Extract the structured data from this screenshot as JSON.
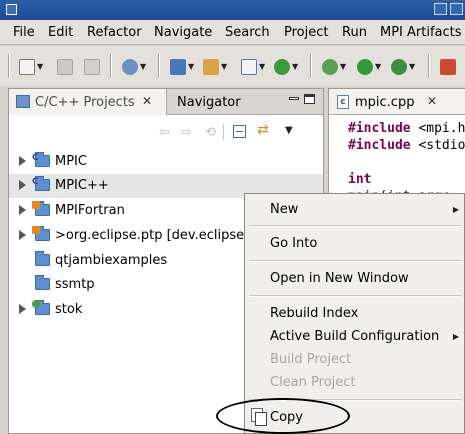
{
  "menubar": {
    "items": [
      "File",
      "Edit",
      "Refactor",
      "Navigate",
      "Search",
      "Project",
      "Run",
      "MPI Artifacts"
    ]
  },
  "project_view": {
    "tabs": [
      {
        "label": "C/C++ Projects",
        "active": true
      },
      {
        "label": "Navigator",
        "active": false
      }
    ],
    "tree": [
      {
        "label": "MPIC",
        "expandable": true,
        "selected": false,
        "overlay": "c"
      },
      {
        "label": "MPIC++",
        "expandable": true,
        "selected": true,
        "overlay": "c"
      },
      {
        "label": "MPIFortran",
        "expandable": true,
        "selected": false,
        "overlay": "m"
      },
      {
        "label": ">org.eclipse.ptp  [dev.eclipse",
        "expandable": true,
        "selected": false,
        "overlay": "m"
      },
      {
        "label": "qtjambiexamples",
        "expandable": false,
        "selected": false,
        "overlay": ""
      },
      {
        "label": "ssmtp",
        "expandable": false,
        "selected": false,
        "overlay": ""
      },
      {
        "label": "stok",
        "expandable": true,
        "selected": false,
        "overlay": "s"
      }
    ]
  },
  "editor": {
    "tab_label": "mpic.cpp",
    "code_lines": [
      {
        "kw": "#include",
        "rest": " <mpi.h"
      },
      {
        "kw": "#include",
        "rest": " <stdio"
      },
      {
        "kw": "",
        "rest": ""
      },
      {
        "kw": "int",
        "rest": ""
      },
      {
        "kw": "",
        "rest": "main(int argc"
      }
    ]
  },
  "context_menu": {
    "items": {
      "new": "New",
      "go_into": "Go Into",
      "open_new_window": "Open in New Window",
      "rebuild_index": "Rebuild Index",
      "active_build_config": "Active Build Configuration",
      "build_project": "Build Project",
      "clean_project": "Clean Project",
      "copy": "Copy"
    }
  },
  "colors": {
    "titlebar": "#1b4a93",
    "keyword": "#7f0055",
    "disabled_text": "#a8a6a2"
  }
}
